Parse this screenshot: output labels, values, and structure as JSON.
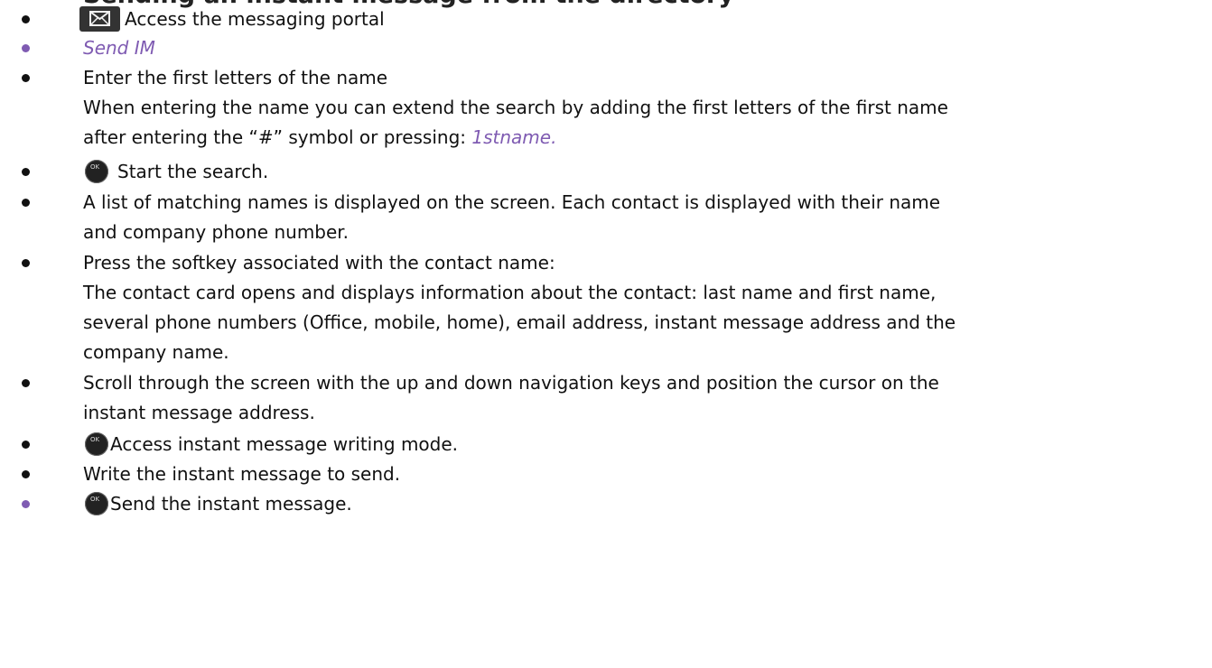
{
  "document": {
    "cut_heading": "Sending an instant message from the directory",
    "items": [
      {
        "icon": "message-icon",
        "text": "Access the messaging portal"
      },
      {
        "text": "Send IM"
      },
      {
        "text": "Enter the first letters of the name",
        "detail_line_1": "When entering the name you can extend the search by adding the first letters of the first name",
        "detail_line_2_prefix": "after entering the “#” symbol or pressing: ",
        "detail_line_2_link": "1stname."
      },
      {
        "icon": "ok-button-icon",
        "icon_label": "OK",
        "text": "Start the search."
      },
      {
        "line_1": "A list of matching names is displayed on the screen. Each contact is displayed with their name",
        "line_2": "and company phone number."
      },
      {
        "text": "Press the softkey associated with the contact name:",
        "detail_line_1": "The contact card opens and displays information about the contact: last name and first name,",
        "detail_line_2": "several phone numbers (Office, mobile, home), email address, instant message address and the",
        "detail_line_3": "company name."
      },
      {
        "line_1": "Scroll through the screen with the up and down navigation keys and position the cursor on the",
        "line_2": "instant message address."
      },
      {
        "icon": "ok-button-icon",
        "icon_label": "OK",
        "text": "Access instant message writing mode."
      },
      {
        "text": "Write the instant message to send."
      },
      {
        "icon": "ok-button-icon",
        "icon_label": "OK",
        "text": "Send the instant message."
      }
    ]
  },
  "colors": {
    "accent": "#7f5bb2",
    "text": "#111111",
    "icon_dark": "#222222"
  }
}
